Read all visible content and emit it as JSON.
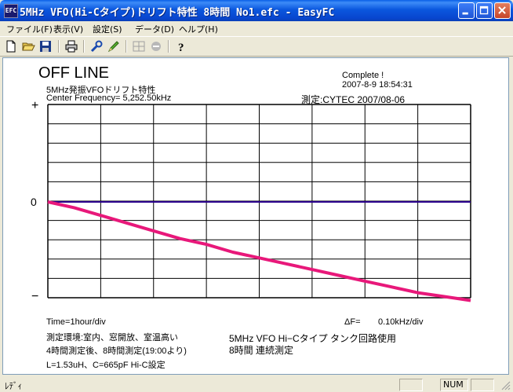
{
  "window": {
    "icon_text": "EFC",
    "title": "5MHz VFO(Hi-Cタイプ)ドリフト特性 8時間 No1.efc - EasyFC"
  },
  "menu": [
    {
      "label": "ファイル(F)"
    },
    {
      "label": "表示(V)"
    },
    {
      "label": "設定(S)"
    },
    {
      "label": "データ(D)"
    },
    {
      "label": "ヘルプ(H)"
    }
  ],
  "toolbar_icons": [
    "new-file-icon",
    "open-folder-icon",
    "save-icon",
    "print-icon",
    "wrench-icon",
    "pen-icon",
    "chart-icon",
    "stop-icon",
    "help-icon"
  ],
  "plot": {
    "status": "OFF LINE",
    "subtitle": "5MHz発振VFOドリフト特性",
    "center_frequency": "Center Frequency=  5,252.50kHz",
    "complete": "Complete !",
    "timestamp": "2007-8-9   18:54:31",
    "measured_by": "測定:CYTEC  2007/08-06",
    "y_plus": "+",
    "y_zero": "0",
    "y_minus": "−",
    "time_scale": "Time=1hour/div",
    "delta_f_label": "ΔF=",
    "delta_f_value": "0.10kHz/div",
    "notes": [
      "測定環境:室内、窓開放、室温高い",
      "4時間測定後、8時間測定(19:00より)",
      "L=1.53uH、C=665pF  Hi-C設定"
    ],
    "comment_lines": [
      "5MHz  VFO  Hi−Cタイプ  タンク回路使用",
      "8時間  連続測定"
    ]
  },
  "chart_data": {
    "type": "line",
    "x_divisions": 8,
    "y_divisions": 10,
    "xlabel": "Time=1hour/div",
    "ylabel": "ΔF=0.10kHz/div",
    "baseline": 0,
    "series": [
      {
        "x": [
          0,
          0.5,
          1,
          1.5,
          2,
          2.5,
          3,
          3.5,
          4,
          4.5,
          5,
          5.5,
          6,
          6.5,
          7,
          7.5,
          8
        ],
        "y": [
          0,
          -0.03,
          -0.07,
          -0.11,
          -0.15,
          -0.19,
          -0.22,
          -0.26,
          -0.29,
          -0.32,
          -0.35,
          -0.38,
          -0.41,
          -0.44,
          -0.47,
          -0.49,
          -0.51
        ]
      }
    ],
    "colors": {
      "trace": "#E8187A",
      "baseline": "#2A008C",
      "grid": "#000000"
    }
  },
  "status_bar": {
    "ready": "ﾚﾃﾞｨ",
    "num": "NUM"
  }
}
